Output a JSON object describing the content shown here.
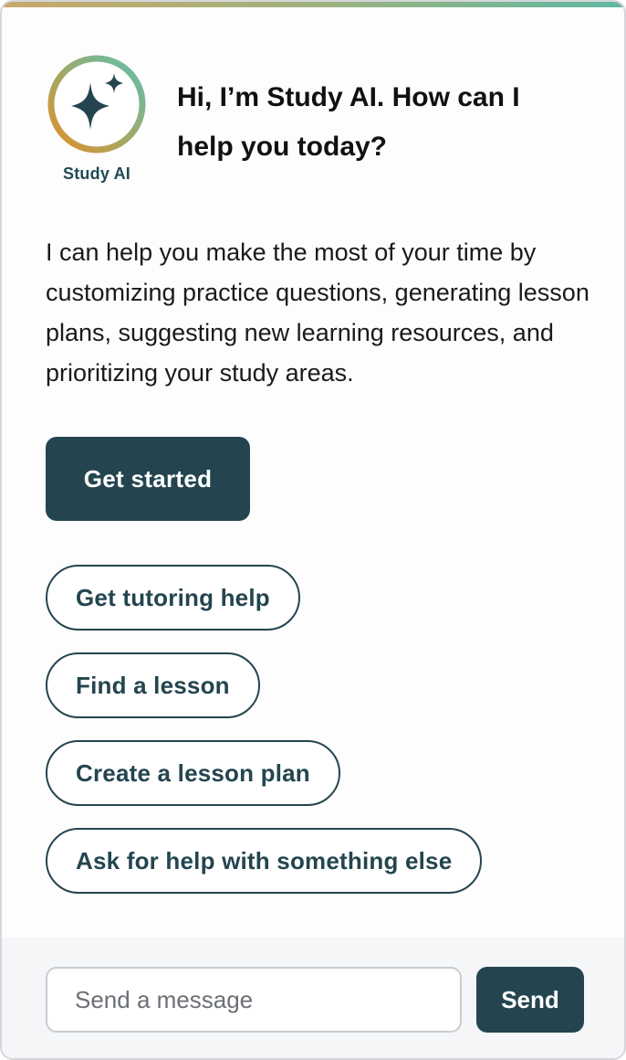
{
  "theme": {
    "primary": "#24454f",
    "avatar_ring_start": "#5fc0b0",
    "avatar_ring_end": "#e0902a",
    "accent_bar": "#9fb27d"
  },
  "assistant": {
    "avatar_icon": "sparkle-icon",
    "name": "Study AI",
    "greeting": "Hi, I’m Study AI. How can I help you today?",
    "intro": "I can help you make the most of your time by customizing practice questions, generating lesson plans, suggesting new learning resources, and prioritizing your study areas."
  },
  "actions": {
    "get_started": "Get started"
  },
  "suggestions": [
    {
      "label": "Get tutoring help"
    },
    {
      "label": "Find a lesson"
    },
    {
      "label": "Create a lesson plan"
    },
    {
      "label": "Ask for help with something else"
    }
  ],
  "composer": {
    "placeholder": "Send a message",
    "send_label": "Send"
  }
}
